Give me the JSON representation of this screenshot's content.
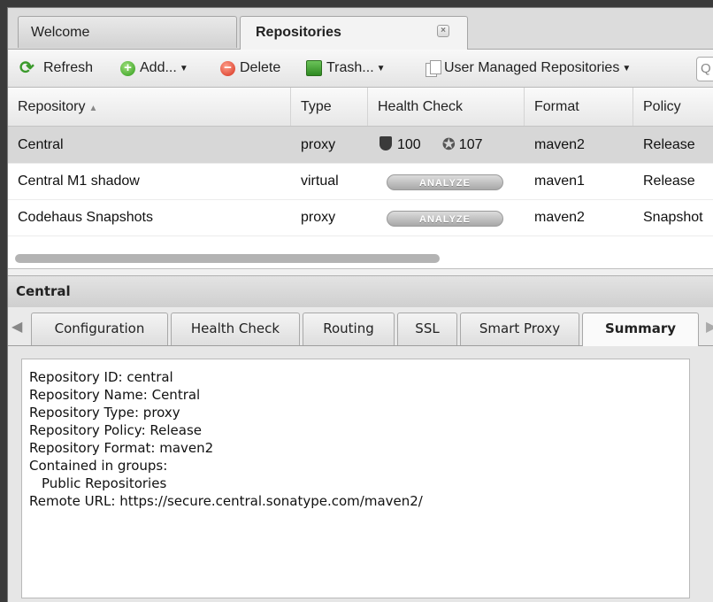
{
  "tabs": {
    "welcome": "Welcome",
    "repositories": "Repositories",
    "close_glyph": "×"
  },
  "toolbar": {
    "refresh": "Refresh",
    "add": "Add...",
    "delete": "Delete",
    "trash": "Trash...",
    "user_managed": "User Managed Repositories",
    "search_glyph": "Q"
  },
  "grid": {
    "columns": [
      "Repository",
      "Type",
      "Health Check",
      "Format",
      "Policy"
    ],
    "rows": [
      {
        "repository": "Central",
        "type": "proxy",
        "health_security": "100",
        "health_license": "107",
        "format": "maven2",
        "policy": "Release"
      },
      {
        "repository": "Central M1 shadow",
        "type": "virtual",
        "health_button": "ANALYZE",
        "format": "maven1",
        "policy": "Release"
      },
      {
        "repository": "Codehaus Snapshots",
        "type": "proxy",
        "health_button": "ANALYZE",
        "format": "maven2",
        "policy": "Snapshot"
      }
    ]
  },
  "detail": {
    "title": "Central",
    "tabs": [
      "Configuration",
      "Health Check",
      "Routing",
      "SSL",
      "Smart Proxy",
      "Summary"
    ],
    "active_tab": "Summary",
    "summary_lines": [
      "Repository ID: central",
      "Repository Name: Central",
      "Repository Type: proxy",
      "Repository Policy: Release",
      "Repository Format: maven2",
      "Contained in groups:",
      "Public Repositories",
      "Remote URL: https://secure.central.sonatype.com/maven2/"
    ]
  },
  "colors": {
    "selected_row": "#d7d7d7",
    "refresh_green": "#3b9a2c",
    "delete_red": "#d5301d"
  }
}
